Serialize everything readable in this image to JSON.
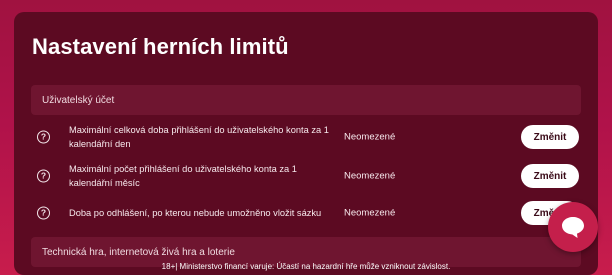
{
  "page": {
    "title": "Nastavení herních limitů"
  },
  "sections": [
    {
      "header": "Uživatelský účet",
      "rows": [
        {
          "label": "Maximální celková doba přihlášení do uživatelského konta za 1 kalendářní den",
          "value": "Neomezené",
          "button": "Změnit"
        },
        {
          "label": "Maximální počet přihlášení do uživatelského konta za 1 kalendářní měsíc",
          "value": "Neomezené",
          "button": "Změnit"
        },
        {
          "label": "Doba po odhlášení, po kterou nebude umožněno vložit sázku",
          "value": "Neomezené",
          "button": "Změnit"
        }
      ]
    },
    {
      "header": "Technická hra, internetová živá hra a loterie"
    }
  ],
  "icons": {
    "help": "question-circle-icon",
    "chat": "chat-bubble-icon"
  },
  "footer": {
    "note": "18+| Ministerstvo financí varuje: Účastí na hazardní hře může vzniknout závislost."
  },
  "colors": {
    "background": "#b0124a",
    "panel": "#5c0a22",
    "section_header": "#6f1530",
    "button_bg": "#ffffff",
    "chat_fab": "#c41f4b"
  }
}
